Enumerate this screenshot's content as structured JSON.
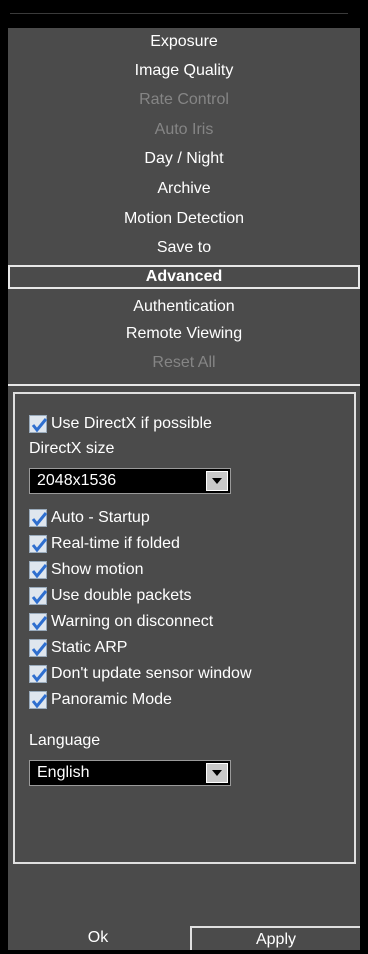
{
  "menu": {
    "items": [
      {
        "label": "Exposure",
        "state": "enabled"
      },
      {
        "label": "Image Quality",
        "state": "enabled"
      },
      {
        "label": "Rate Control",
        "state": "disabled"
      },
      {
        "label": "Auto Iris",
        "state": "disabled"
      },
      {
        "label": "Day / Night",
        "state": "enabled"
      },
      {
        "label": "Archive",
        "state": "enabled"
      },
      {
        "label": "Motion Detection",
        "state": "enabled"
      },
      {
        "label": "Save to",
        "state": "enabled"
      },
      {
        "label": "Advanced",
        "state": "selected"
      },
      {
        "label": "Authentication",
        "state": "enabled"
      },
      {
        "label": "Remote Viewing",
        "state": "enabled"
      },
      {
        "label": "Reset All",
        "state": "disabled"
      }
    ]
  },
  "settings": {
    "use_directx": {
      "label": "Use DirectX if possible",
      "checked": true
    },
    "directx_size_label": "DirectX size",
    "directx_size_value": "2048x1536",
    "checkboxes": [
      {
        "label": "Auto - Startup",
        "checked": true
      },
      {
        "label": "Real-time if folded",
        "checked": true
      },
      {
        "label": "Show motion",
        "checked": true
      },
      {
        "label": "Use double packets",
        "checked": true
      },
      {
        "label": "Warning on disconnect",
        "checked": true
      },
      {
        "label": "Static ARP",
        "checked": true
      },
      {
        "label": "Don't update sensor window",
        "checked": true
      },
      {
        "label": "Panoramic Mode",
        "checked": true
      }
    ],
    "language_label": "Language",
    "language_value": "English"
  },
  "footer": {
    "ok_label": "Ok",
    "apply_label": "Apply"
  },
  "colors": {
    "panel": "#4b4b4b",
    "frame": "#e8e8e8",
    "disabled_text": "#858585",
    "check": "#2f6fcf"
  }
}
